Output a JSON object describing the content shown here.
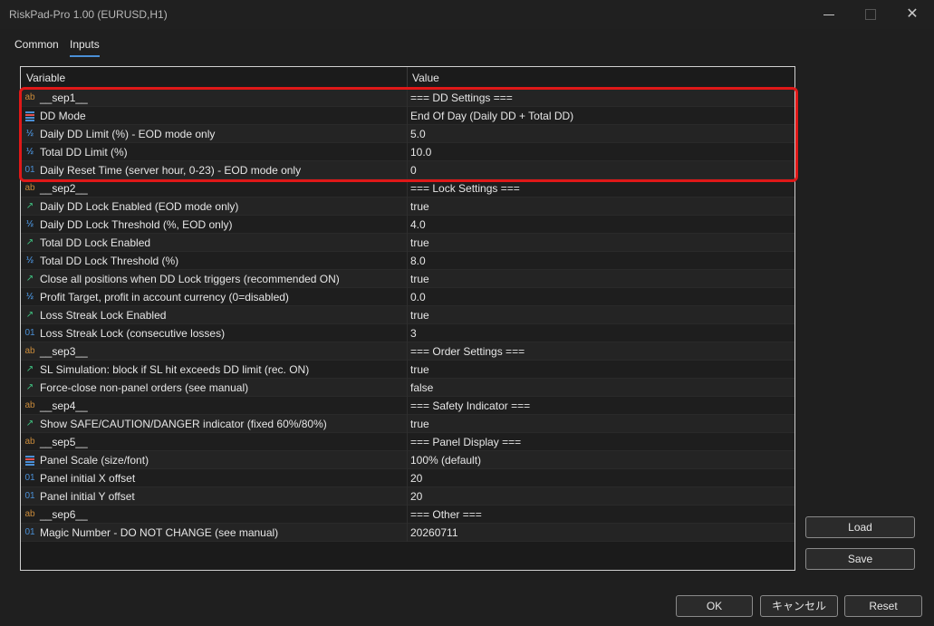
{
  "window": {
    "title": "RiskPad-Pro 1.00 (EURUSD,H1)"
  },
  "tabs": [
    {
      "label": "Common"
    },
    {
      "label": "Inputs"
    }
  ],
  "grid": {
    "headers": {
      "variable": "Variable",
      "value": "Value"
    },
    "rows": [
      {
        "icon": "ab",
        "variable": "__sep1__",
        "value": "=== DD Settings ==="
      },
      {
        "icon": "enum",
        "variable": "DD Mode",
        "value": "End Of Day (Daily DD + Total DD)"
      },
      {
        "icon": "half",
        "variable": "Daily DD Limit (%) - EOD mode only",
        "value": "5.0"
      },
      {
        "icon": "half",
        "variable": "Total DD Limit (%)",
        "value": "10.0"
      },
      {
        "icon": "01",
        "variable": "Daily Reset Time (server hour, 0-23) - EOD mode only",
        "value": "0"
      },
      {
        "icon": "ab",
        "variable": "__sep2__",
        "value": "=== Lock Settings ==="
      },
      {
        "icon": "bool",
        "variable": "Daily DD Lock Enabled (EOD mode only)",
        "value": "true"
      },
      {
        "icon": "half",
        "variable": "Daily DD Lock Threshold (%, EOD only)",
        "value": "4.0"
      },
      {
        "icon": "bool",
        "variable": "Total DD Lock Enabled",
        "value": "true"
      },
      {
        "icon": "half",
        "variable": "Total DD Lock Threshold (%)",
        "value": "8.0"
      },
      {
        "icon": "bool",
        "variable": "Close all positions when DD Lock triggers (recommended ON)",
        "value": "true"
      },
      {
        "icon": "half",
        "variable": "Profit Target, profit in account currency (0=disabled)",
        "value": "0.0"
      },
      {
        "icon": "bool",
        "variable": "Loss Streak Lock Enabled",
        "value": "true"
      },
      {
        "icon": "01",
        "variable": "Loss Streak Lock (consecutive losses)",
        "value": "3"
      },
      {
        "icon": "ab",
        "variable": "__sep3__",
        "value": "=== Order Settings ==="
      },
      {
        "icon": "bool",
        "variable": "SL Simulation: block if SL hit exceeds DD limit (rec. ON)",
        "value": "true"
      },
      {
        "icon": "bool",
        "variable": "Force-close non-panel orders (see manual)",
        "value": "false"
      },
      {
        "icon": "ab",
        "variable": "__sep4__",
        "value": "=== Safety Indicator ==="
      },
      {
        "icon": "bool",
        "variable": "Show SAFE/CAUTION/DANGER indicator (fixed 60%/80%)",
        "value": "true"
      },
      {
        "icon": "ab",
        "variable": "__sep5__",
        "value": "=== Panel Display ==="
      },
      {
        "icon": "enum",
        "variable": "Panel Scale (size/font)",
        "value": "100% (default)"
      },
      {
        "icon": "01",
        "variable": "Panel initial X offset",
        "value": "20"
      },
      {
        "icon": "01",
        "variable": "Panel initial Y offset",
        "value": "20"
      },
      {
        "icon": "ab",
        "variable": "__sep6__",
        "value": "=== Other ==="
      },
      {
        "icon": "01",
        "variable": "Magic Number - DO NOT CHANGE (see manual)",
        "value": "20260711"
      }
    ]
  },
  "buttons": {
    "load": "Load",
    "save": "Save",
    "ok": "OK",
    "cancel": "キャンセル",
    "reset": "Reset"
  },
  "colors": {
    "highlight": "#e01818",
    "accent": "#4a8fd6",
    "bool_icon": "#3fbf7f",
    "string_icon": "#c88a3a"
  }
}
